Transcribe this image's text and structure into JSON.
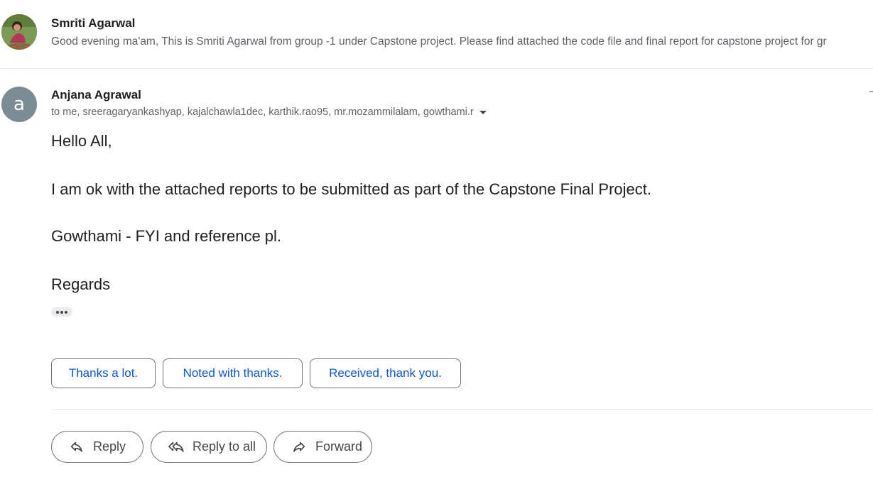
{
  "thread": {
    "collapsed_message": {
      "sender": "Smriti Agarwal",
      "snippet": "Good evening ma'am, This is Smriti Agarwal from group -1 under Capstone project. Please find attached the code file and final report for capstone project for gr"
    },
    "open_message": {
      "avatar_letter": "a",
      "avatar_color": "#7b8c95",
      "sender": "Anjana Agrawal",
      "recipients": "to me, sreeragaryankashyap, kajalchawla1dec, karthik.rao95, mr.mozammilalam, gowthami.r",
      "body": {
        "greeting": "Hello All,",
        "line1": "I am ok with the attached reports to be submitted as part of the Capstone Final Project.",
        "line2": "Gowthami - FYI and reference pl.",
        "signoff": "Regards"
      }
    }
  },
  "smart_replies": {
    "reply1": "Thanks a lot.",
    "reply2": "Noted with thanks.",
    "reply3": "Received, thank you."
  },
  "actions": {
    "reply": "Reply",
    "reply_all": "Reply to all",
    "forward": "Forward"
  },
  "icons": [
    "reply-icon",
    "reply-all-icon",
    "forward-icon",
    "chevron-down-icon",
    "more-icon"
  ],
  "colors": {
    "link_blue": "#0b57d0",
    "secondary_text": "#5f6368"
  }
}
